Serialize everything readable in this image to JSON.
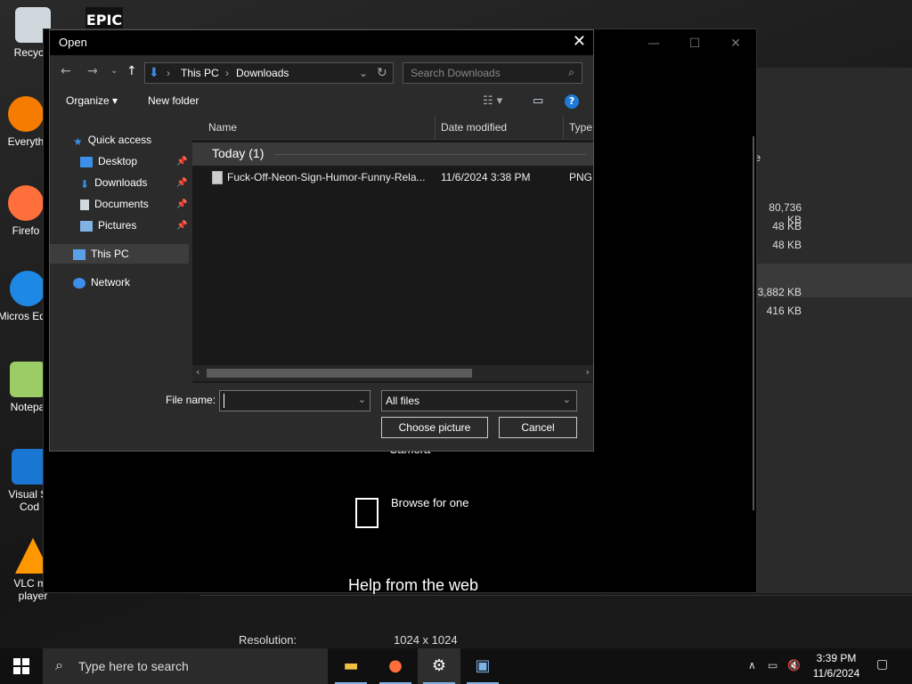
{
  "desktop": {
    "icons": [
      {
        "label": "Recycle",
        "color": "#cfd8dc"
      },
      {
        "label": "Everyth",
        "color": "#f57c00"
      },
      {
        "label": "Firefo",
        "color": "#ff6f3c"
      },
      {
        "label": "Micros Edge",
        "color": "#1e88e5"
      },
      {
        "label": "Notepa",
        "color": "#9ccc65"
      },
      {
        "label": "Visual St Cod",
        "color": "#1976d2"
      },
      {
        "label": "VLC me player",
        "color": "#ff9800"
      }
    ],
    "epic_label": "EPIC"
  },
  "background_window": {
    "camera_label": "Camera",
    "browse_label": "Browse for one",
    "help_label": "Help from the web",
    "resolution_label": "Resolution:",
    "resolution_value": "1024 x 1024",
    "right_sizes": [
      "80,736 KB",
      "48 KB",
      "48 KB",
      "3,882 KB",
      "416 KB"
    ],
    "right_partial": "e"
  },
  "dialog": {
    "title": "Open",
    "breadcrumb": [
      "This PC",
      "Downloads"
    ],
    "search_placeholder": "Search Downloads",
    "toolbar": {
      "organize": "Organize",
      "new_folder": "New folder",
      "help": "?"
    },
    "nav": {
      "quick_access": "Quick access",
      "items": [
        "Desktop",
        "Downloads",
        "Documents",
        "Pictures"
      ],
      "this_pc": "This PC",
      "network": "Network"
    },
    "columns": {
      "name": "Name",
      "date": "Date modified",
      "type": "Type"
    },
    "group": "Today (1)",
    "files": [
      {
        "name": "Fuck-Off-Neon-Sign-Humor-Funny-Rela...",
        "date": "11/6/2024 3:38 PM",
        "type": "PNG"
      }
    ],
    "file_name_label": "File name:",
    "file_name_value": "",
    "filter": "All files",
    "choose_button": "Choose picture",
    "cancel_button": "Cancel"
  },
  "taskbar": {
    "search_placeholder": "Type here to search",
    "time": "3:39 PM",
    "date": "11/6/2024"
  }
}
